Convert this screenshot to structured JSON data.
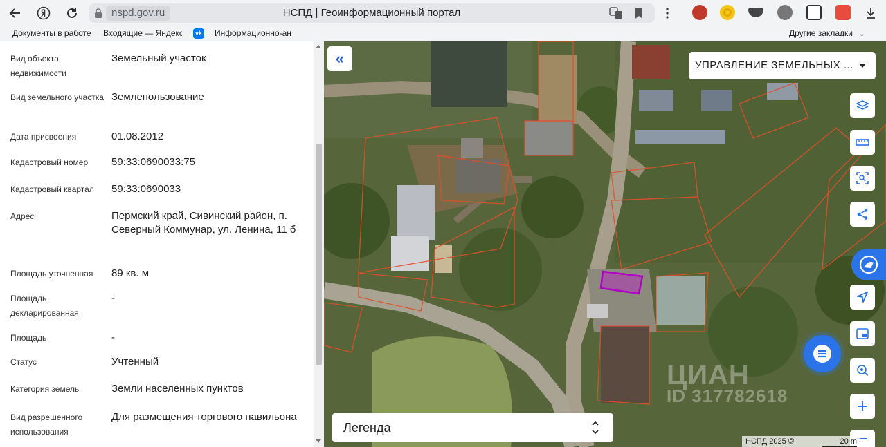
{
  "browser": {
    "url": "nspd.gov.ru",
    "title": "НСПД | Геоинформационный портал",
    "bookmarks": [
      "Документы в работе",
      "Входящие — Яндекс",
      "Информационно-ан"
    ],
    "bookmarks_vk_label": "vk",
    "other_bookmarks": "Другие закладки"
  },
  "info_panel": {
    "rows": [
      {
        "label": "Вид объекта недвижимости",
        "value": "Земельный участок"
      },
      {
        "label": "Вид земельного участка",
        "value": "Землепользование"
      },
      {
        "label": "Дата присвоения",
        "value": "01.08.2012"
      },
      {
        "label": "Кадастровый номер",
        "value": "59:33:0690033:75"
      },
      {
        "label": "Кадастровый квартал",
        "value": "59:33:0690033"
      },
      {
        "label": "Адрес",
        "value": "Пермский край, Сивинский район, п. Северный Коммунар, ул. Ленина, 11 б"
      },
      {
        "label": "Площадь уточненная",
        "value": "89 кв. м"
      },
      {
        "label": "Площадь декларированная",
        "value": "-"
      },
      {
        "label": "Площадь",
        "value": "-"
      },
      {
        "label": "Статус",
        "value": "Учтенный"
      },
      {
        "label": "Категория земель",
        "value": "Земли населенных пунктов"
      },
      {
        "label": "Вид разрешенного использования",
        "value": "Для размещения торгового павильона"
      }
    ]
  },
  "map": {
    "layer_select": "УПРАВЛЕНИЕ ЗЕМЕЛЬНЫХ ...",
    "legend": "Легенда",
    "attribution": "НСПД 2025 ©",
    "scale": "20 m",
    "watermark_brand": "ЦИАН",
    "watermark_id": "ID 317782618",
    "accent_color": "#2a73e8",
    "parcel_outline_color": "#e0502a",
    "selected_parcel_color": "#b000c8"
  }
}
